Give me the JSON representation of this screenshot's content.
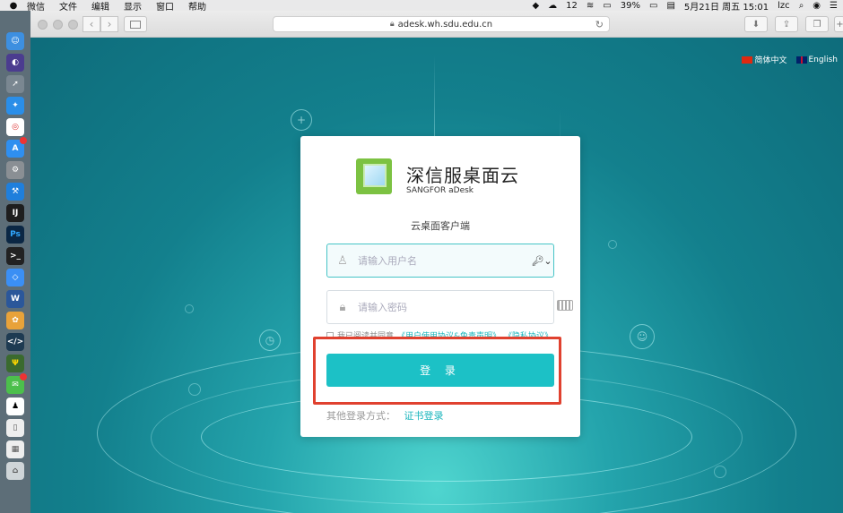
{
  "menubar": {
    "app_name": "微信",
    "items": [
      "文件",
      "编辑",
      "显示",
      "窗口",
      "帮助"
    ],
    "wechat_count": "12",
    "battery": "39%",
    "date_time": "5月21日 周五 15:01",
    "user": "lzc"
  },
  "browser": {
    "url": "adesk.wh.sdu.edu.cn"
  },
  "lang": {
    "chinese": "简体中文",
    "english": "English"
  },
  "login": {
    "brand": "深信服桌面云",
    "brand_sub": "SANGFOR aDesk",
    "subtitle": "云桌面客户端",
    "username_placeholder": "请输入用户名",
    "password_placeholder": "请输入密码",
    "agree_prefix": "我已阅读并同意",
    "agree_link1": "《用户使用协议&免责声明》",
    "agree_link2": "《隐私协议》",
    "login_button": "登 录",
    "other_methods": "其他登录方式：",
    "cert_login": "证书登录"
  },
  "colors": {
    "accent": "#1cc1c6",
    "highlight_box": "#e0412f"
  }
}
